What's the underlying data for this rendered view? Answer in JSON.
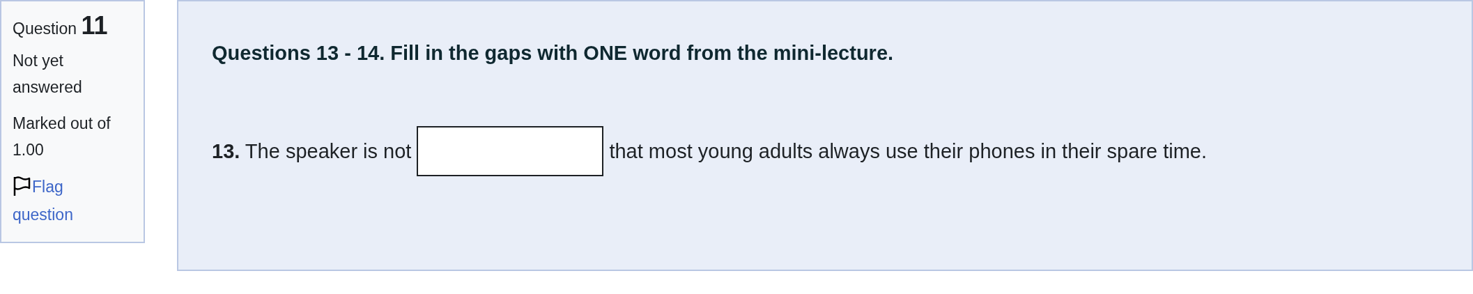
{
  "question_info": {
    "label": "Question",
    "number": "11",
    "status": "Not yet answered",
    "marks": "Marked out of 1.00",
    "flag": {
      "label": "Flag question",
      "flagged": false
    }
  },
  "content": {
    "instruction": "Questions 13 - 14. Fill in the gaps with ONE word from the mini-lecture.",
    "gap_item": {
      "before": "**13.** The speaker is not",
      "after": "that most young adults always use their phones in their spare time."
    }
  }
}
